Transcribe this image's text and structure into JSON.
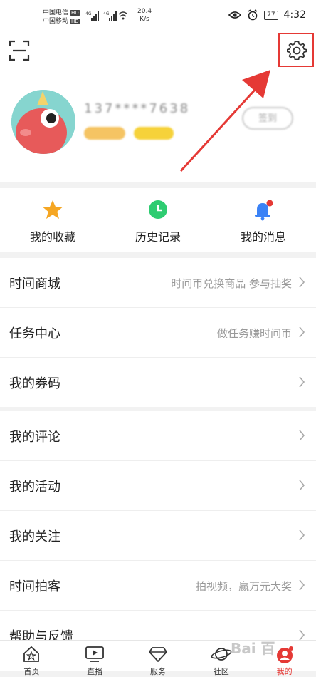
{
  "status_bar": {
    "carrier1": "中国电信",
    "carrier2": "中国移动",
    "hd_label": "HD",
    "net_speed_value": "20.4",
    "net_speed_unit": "K/s",
    "battery": "77",
    "time": "4:32"
  },
  "profile": {
    "nickname": "137****7638",
    "sign_in_label": "签到"
  },
  "quick_actions": [
    {
      "label": "我的收藏",
      "icon": "star-icon",
      "color": "#f5a623"
    },
    {
      "label": "历史记录",
      "icon": "clock-icon",
      "color": "#2ecc71"
    },
    {
      "label": "我的消息",
      "icon": "bell-icon",
      "color": "#3b82f6"
    }
  ],
  "menu_group1": [
    {
      "label": "时间商城",
      "desc": "时间币兑换商品 参与抽奖"
    },
    {
      "label": "任务中心",
      "desc": "做任务赚时间币"
    },
    {
      "label": "我的券码",
      "desc": ""
    }
  ],
  "menu_group2": [
    {
      "label": "我的评论",
      "desc": ""
    },
    {
      "label": "我的活动",
      "desc": ""
    },
    {
      "label": "我的关注",
      "desc": ""
    },
    {
      "label": "时间拍客",
      "desc": "拍视频，赢万元大奖"
    },
    {
      "label": "帮助与反馈",
      "desc": ""
    }
  ],
  "tab_bar": [
    {
      "label": "首页",
      "icon": "home-icon"
    },
    {
      "label": "直播",
      "icon": "tv-icon"
    },
    {
      "label": "服务",
      "icon": "diamond-icon"
    },
    {
      "label": "社区",
      "icon": "planet-icon"
    },
    {
      "label": "我的",
      "icon": "profile-icon"
    }
  ],
  "watermark": "Bai 百",
  "colors": {
    "accent": "#e53935",
    "annotation": "#e53935"
  }
}
